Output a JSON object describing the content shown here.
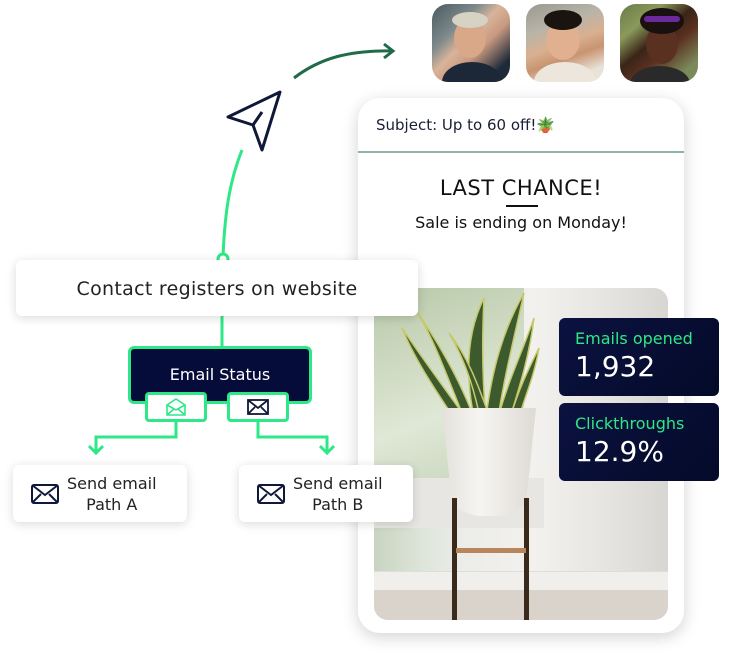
{
  "avatars": [
    {
      "name": "contact-avatar-1",
      "description": "woman with short blonde hair"
    },
    {
      "name": "contact-avatar-2",
      "description": "smiling man with dark hair"
    },
    {
      "name": "contact-avatar-3",
      "description": "laughing woman with curly hair and purple headband"
    }
  ],
  "icons": {
    "send": "paper-plane-icon",
    "email_open": "envelope-open-icon",
    "email_closed": "envelope-icon"
  },
  "email": {
    "subject": "Subject: Up to 60 off!🪴",
    "headline": "LAST CHANCE!",
    "subline": "Sale is ending on Monday!",
    "image_description": "snake plant in white pot on wooden stand"
  },
  "stats": [
    {
      "label": "Emails opened",
      "value": "1,932"
    },
    {
      "label": "Clickthroughs",
      "value": "12.9%"
    }
  ],
  "flow": {
    "trigger": "Contact registers on website",
    "condition": "Email Status",
    "paths": [
      {
        "line1": "Send email",
        "line2": "Path A"
      },
      {
        "line1": "Send email",
        "line2": "Path B"
      }
    ]
  },
  "colors": {
    "accent_green": "#2ee887",
    "dark_green_arrow": "#1f6b4a",
    "navy": "#060c3a",
    "subject_rule": "#8fb3a6"
  }
}
